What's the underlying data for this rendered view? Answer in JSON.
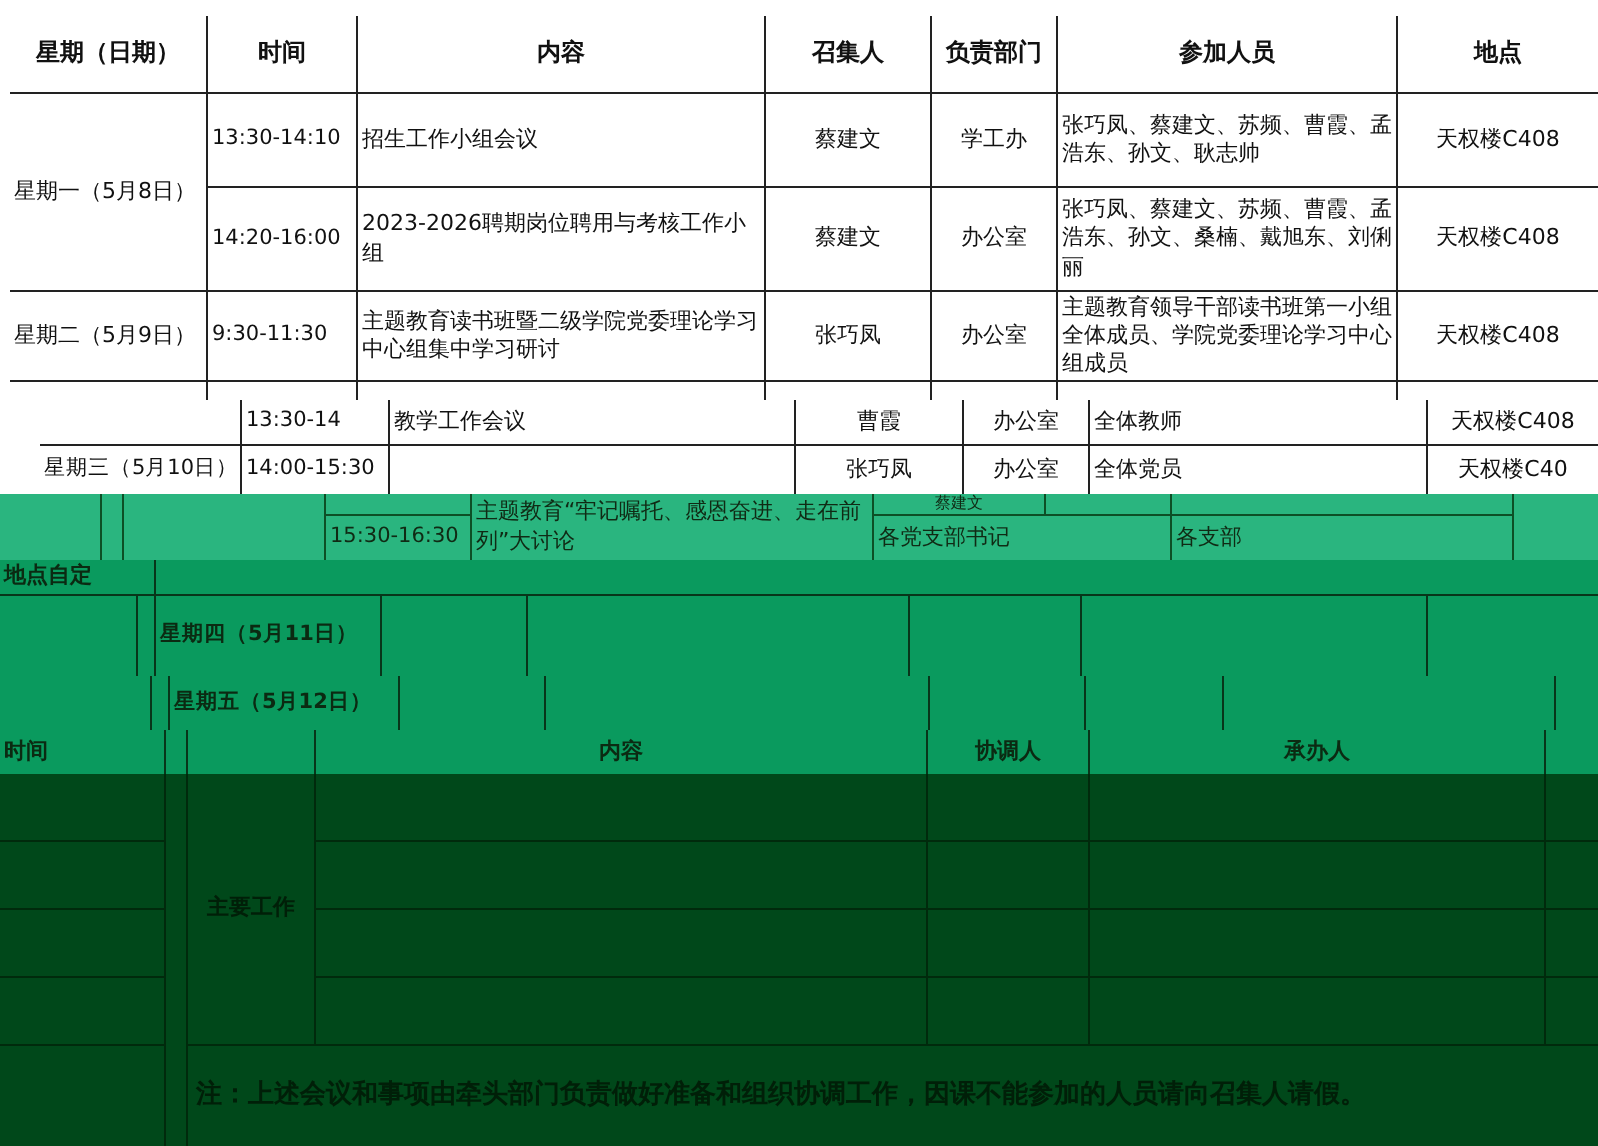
{
  "schedule_table": {
    "columns": [
      "星期（日期）",
      "时间",
      "内容",
      "召集人",
      "负责部门",
      "参加人员",
      "地点"
    ],
    "days": [
      {
        "day": "星期一（5月8日）",
        "meetings": [
          {
            "time": "13:30-14:10",
            "content": "招生工作小组会议",
            "convener": "蔡建文",
            "department": "学工办",
            "attendees": "张巧凤、蔡建文、苏频、曹霞、孟浩东、孙文、耿志帅",
            "location": "天权楼C408"
          },
          {
            "time": "14:20-16:00",
            "content": "2023-2026聘期岗位聘用与考核工作小组",
            "convener": "蔡建文",
            "department": "办公室",
            "attendees": "张巧凤、蔡建文、苏频、曹霞、孟浩东、孙文、桑楠、戴旭东、刘俐丽",
            "location": "天权楼C408"
          }
        ]
      },
      {
        "day": "星期二（5月9日）",
        "meetings": [
          {
            "time": "9:30-11:30",
            "content": "主题教育读书班暨二级学院党委理论学习中心组集中学习研讨",
            "convener": "张巧凤",
            "department": "办公室",
            "attendees": "主题教育领导干部读书班第一小组全体成员、学院党委理论学习中心组成员",
            "location": "天权楼C408"
          }
        ]
      }
    ]
  },
  "shifted_slice": {
    "rows": [
      {
        "time": "13:30-14",
        "content": "教学工作会议",
        "convener": "曹霞",
        "department": "办公室",
        "attendees": "全体教师",
        "location": "天权楼C408"
      },
      {
        "day": "星期三（5月10日）",
        "time": "14:00-15:30",
        "convener": "张巧凤",
        "department": "办公室",
        "attendees": "全体党员",
        "location": "天权楼C40"
      }
    ]
  },
  "green_slice": {
    "time": "15:30-16:30",
    "content": "主题教育“牢记嘱托、感恩奋进、走在前列”大讨论",
    "convener_top": "蔡建文",
    "convener": "各党支部书记",
    "attendees": "各支部"
  },
  "thursday_slice": {
    "location_note": "地点自定",
    "day": "星期四（5月11日）"
  },
  "friday_slice": {
    "day": "星期五（5月12日）"
  },
  "work_table": {
    "columns": [
      "时间",
      "内容",
      "协调人",
      "承办人"
    ],
    "category": "主要工作",
    "note": "注：上述会议和事项由牵头部门负责做好准备和组织协调工作，因课不能参加的人员请向召集人请假。"
  }
}
